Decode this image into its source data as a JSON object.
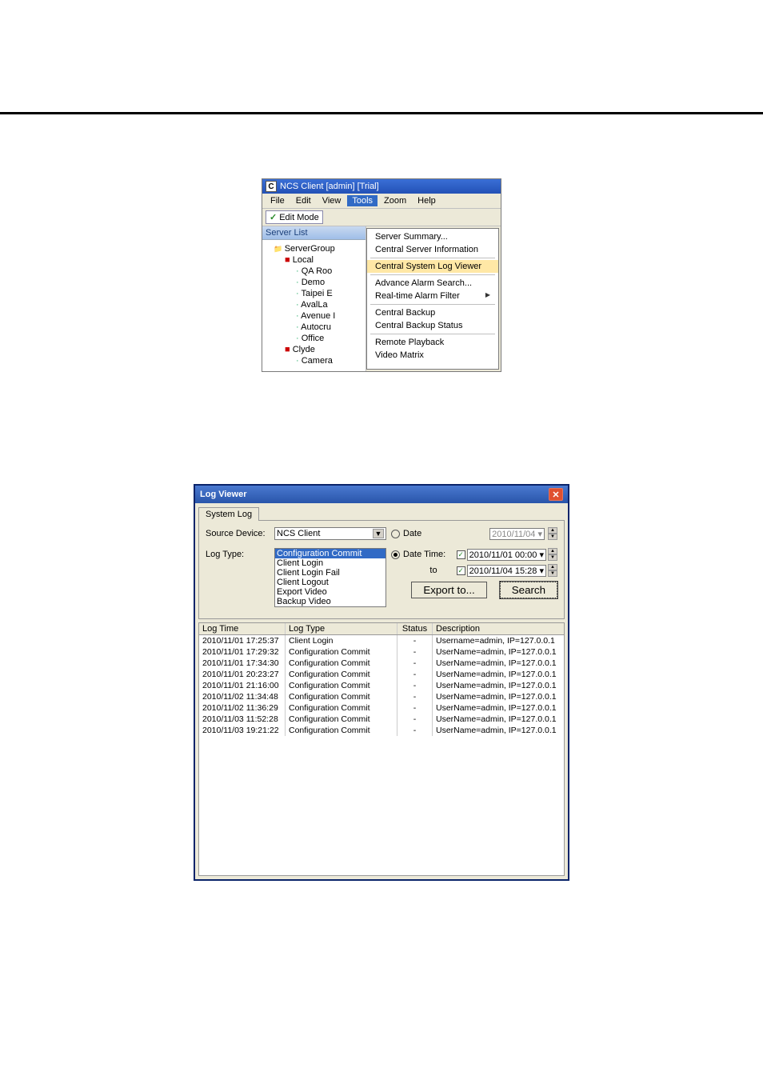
{
  "menuWindow": {
    "title": "NCS Client [admin] [Trial]",
    "menubar": {
      "file": "File",
      "edit": "Edit",
      "view": "View",
      "tools": "Tools",
      "zoom": "Zoom",
      "help": "Help"
    },
    "editMode": "Edit Mode",
    "serverListLabel": "Server List",
    "tree": {
      "root": "ServerGroup",
      "local": "Local",
      "cams": [
        "QA Roo",
        "Demo",
        "Taipei E",
        "AvalLa",
        "Avenue I",
        "Autocru",
        "Office"
      ],
      "clyde": "Clyde",
      "clydeCam": "Camera"
    },
    "toolsMenu": {
      "serverSummary": "Server Summary...",
      "centralServerInfo": "Central Server Information",
      "centralSystemLog": "Central System Log Viewer",
      "advanceAlarm": "Advance Alarm Search...",
      "realtimeFilter": "Real-time Alarm Filter",
      "centralBackup": "Central Backup",
      "centralBackupStatus": "Central Backup Status",
      "remotePlayback": "Remote Playback",
      "videoMatrix": "Video Matrix"
    }
  },
  "logViewer": {
    "title": "Log Viewer",
    "tab": "System Log",
    "labels": {
      "sourceDevice": "Source Device:",
      "logType": "Log Type:",
      "date": "Date",
      "dateTime": "Date Time:",
      "to": "to"
    },
    "sourceDeviceValue": "NCS Client",
    "logTypes": [
      "Configuration Commit",
      "Client Login",
      "Client Login Fail",
      "Client Logout",
      "Export Video",
      "Backup Video"
    ],
    "dateValue": "2010/11/04",
    "dtFrom": "2010/11/01 00:00",
    "dtTo": "2010/11/04 15:28",
    "buttons": {
      "exportTo": "Export to...",
      "search": "Search"
    },
    "columns": {
      "logTime": "Log Time",
      "logType": "Log Type",
      "status": "Status",
      "description": "Description"
    },
    "rows": [
      {
        "time": "2010/11/01 17:25:37",
        "type": "Client Login",
        "status": "-",
        "desc": "Username=admin, IP=127.0.0.1"
      },
      {
        "time": "2010/11/01 17:29:32",
        "type": "Configuration Commit",
        "status": "-",
        "desc": "UserName=admin, IP=127.0.0.1"
      },
      {
        "time": "2010/11/01 17:34:30",
        "type": "Configuration Commit",
        "status": "-",
        "desc": "UserName=admin, IP=127.0.0.1"
      },
      {
        "time": "2010/11/01 20:23:27",
        "type": "Configuration Commit",
        "status": "-",
        "desc": "UserName=admin, IP=127.0.0.1"
      },
      {
        "time": "2010/11/01 21:16:00",
        "type": "Configuration Commit",
        "status": "-",
        "desc": "UserName=admin, IP=127.0.0.1"
      },
      {
        "time": "2010/11/02 11:34:48",
        "type": "Configuration Commit",
        "status": "-",
        "desc": "UserName=admin, IP=127.0.0.1"
      },
      {
        "time": "2010/11/02 11:36:29",
        "type": "Configuration Commit",
        "status": "-",
        "desc": "UserName=admin, IP=127.0.0.1"
      },
      {
        "time": "2010/11/03 11:52:28",
        "type": "Configuration Commit",
        "status": "-",
        "desc": "UserName=admin, IP=127.0.0.1"
      },
      {
        "time": "2010/11/03 19:21:22",
        "type": "Configuration Commit",
        "status": "-",
        "desc": "UserName=admin, IP=127.0.0.1"
      }
    ]
  }
}
